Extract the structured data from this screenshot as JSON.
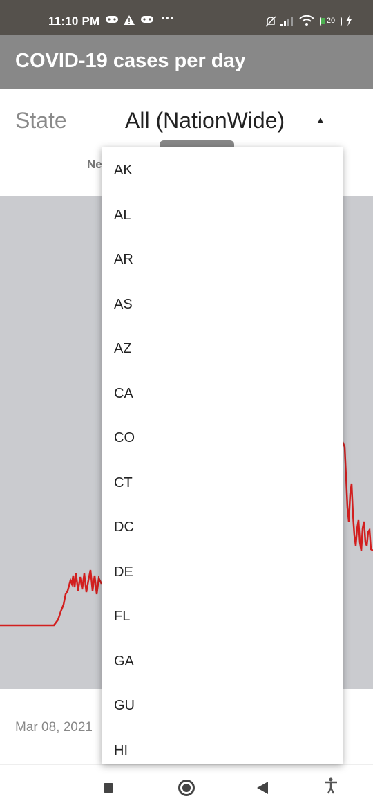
{
  "status_bar": {
    "time": "11:10 PM",
    "more": "···",
    "battery": "20"
  },
  "app_bar": {
    "title": "COVID-19 cases per day"
  },
  "state_selector": {
    "label": "State",
    "selected": "All (NationWide)"
  },
  "chart_header": {
    "partial_label": "Ne"
  },
  "chart": {
    "line_color": "#d21f1f",
    "background": "#cacbcf"
  },
  "footer": {
    "date": "Mar 08, 2021"
  },
  "dropdown": {
    "options": [
      "AK",
      "AL",
      "AR",
      "AS",
      "AZ",
      "CA",
      "CO",
      "CT",
      "DC",
      "DE",
      "FL",
      "GA",
      "GU",
      "HI"
    ]
  }
}
